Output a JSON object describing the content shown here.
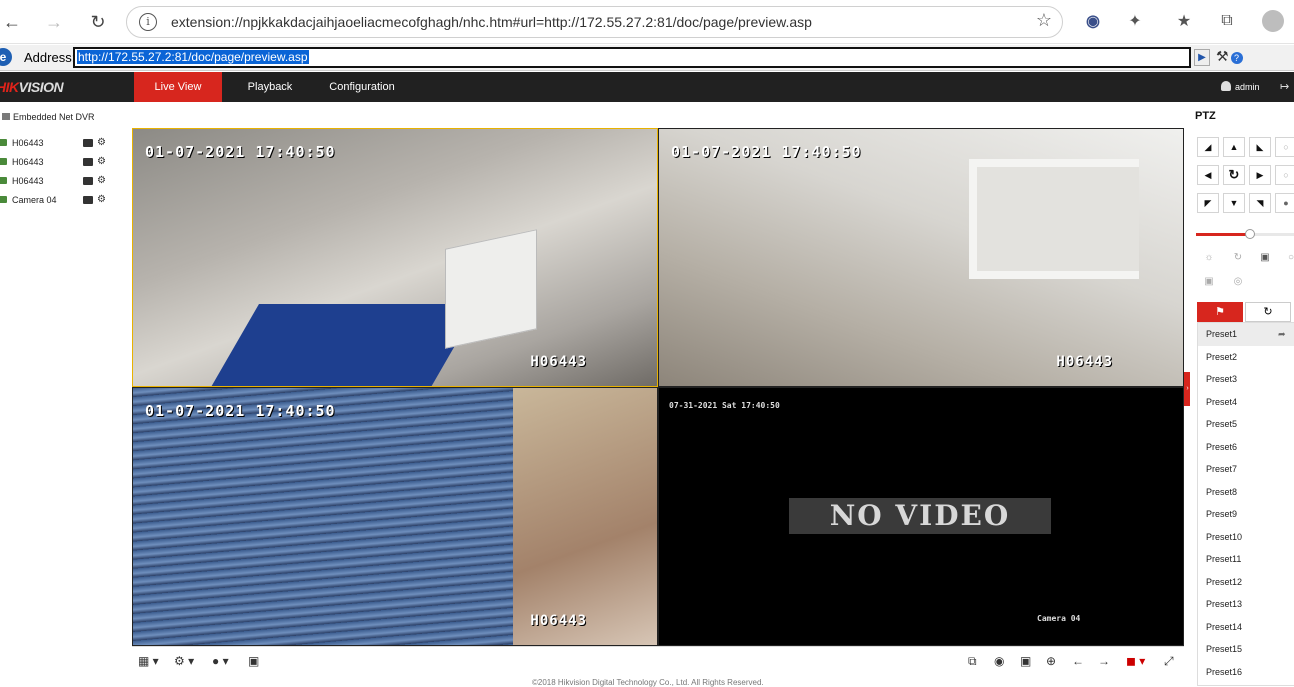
{
  "browser": {
    "url": "extension://npjkkakdacjaihjaoeliacmecofghagh/nhc.htm#url=http://172.55.27.2:81/doc/page/preview.asp",
    "address_label": "Address:",
    "address_value": "http://172.55.27.2:81/doc/page/preview.asp"
  },
  "app": {
    "logo": "HIKVISION",
    "tabs": [
      {
        "label": "Live View",
        "active": true
      },
      {
        "label": "Playback",
        "active": false
      },
      {
        "label": "Configuration",
        "active": false
      }
    ],
    "user": "admin",
    "accent": "#d7261e"
  },
  "tree": {
    "root": "Embedded Net DVR",
    "cameras": [
      "H06443",
      "H06443",
      "H06443",
      "Camera 04"
    ]
  },
  "video": {
    "panes": [
      {
        "timestamp": "01-07-2021 17:40:50",
        "name": "H06443"
      },
      {
        "timestamp": "01-07-2021 17:40:50",
        "name": "H06443"
      },
      {
        "timestamp": "01-07-2021 17:40:50",
        "name": "H06443"
      }
    ],
    "no_video": {
      "timestamp": "07-31-2021 Sat 17:40:50",
      "message": "NO VIDEO",
      "name": "Camera 04"
    }
  },
  "ptz": {
    "title": "PTZ",
    "speed": 0.55,
    "presets": [
      "Preset1",
      "Preset2",
      "Preset3",
      "Preset4",
      "Preset5",
      "Preset6",
      "Preset7",
      "Preset8",
      "Preset9",
      "Preset10",
      "Preset11",
      "Preset12",
      "Preset13",
      "Preset14",
      "Preset15",
      "Preset16"
    ],
    "selected_preset": "Preset1"
  },
  "footer": "©2018 Hikvision Digital Technology Co., Ltd. All Rights Reserved."
}
